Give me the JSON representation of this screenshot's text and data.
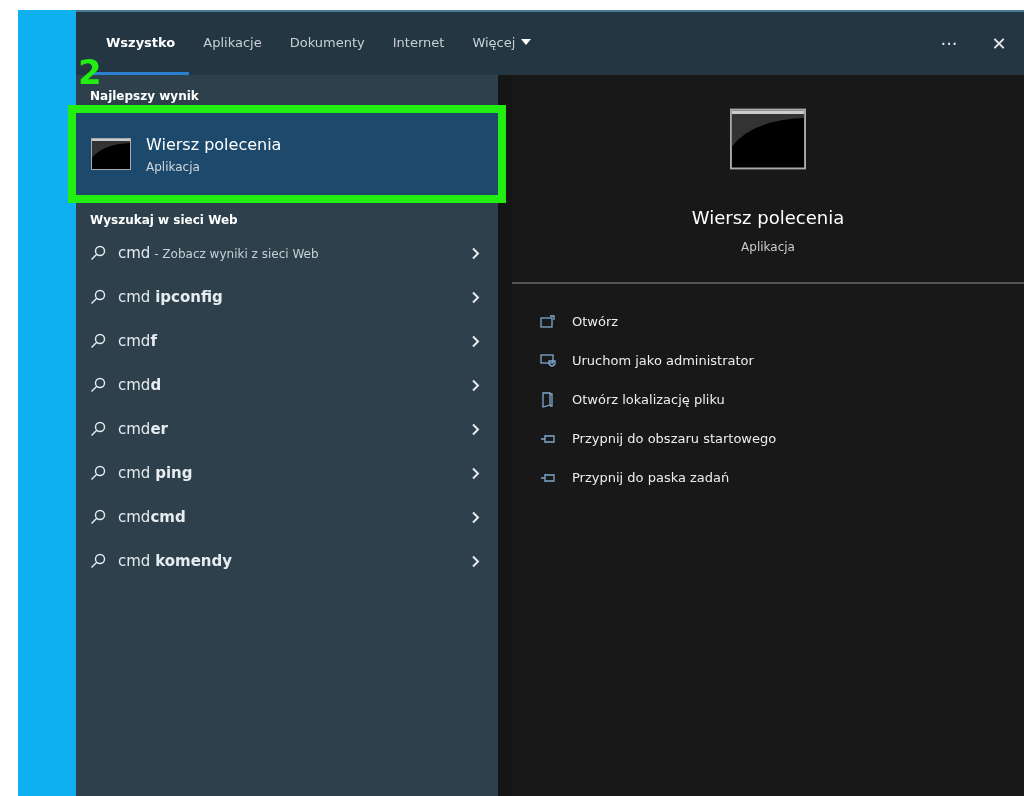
{
  "tabs": [
    {
      "label": "Wszystko",
      "selected": true
    },
    {
      "label": "Aplikacje",
      "selected": false
    },
    {
      "label": "Dokumenty",
      "selected": false
    },
    {
      "label": "Internet",
      "selected": false
    },
    {
      "label": "Więcej",
      "selected": false,
      "kind": "dropdown"
    }
  ],
  "toolbar": {
    "more": "···",
    "close": "✕"
  },
  "annotation": {
    "number": "2",
    "color": "#22ee11"
  },
  "best_match": {
    "heading": "Najlepszy wynik",
    "title": "Wiersz polecenia",
    "subtitle": "Aplikacja",
    "selected": true
  },
  "web": {
    "heading": "Wyszukaj w sieci Web",
    "suggestions": [
      {
        "text": "cmd",
        "hint": "- Zobacz wyniki z sieci Web"
      },
      {
        "text": "cmd **ipconfig**"
      },
      {
        "text": "cmd**f**"
      },
      {
        "text": "cmd**d**"
      },
      {
        "text": "cmd**er**"
      },
      {
        "text": "cmd **ping**"
      },
      {
        "text": "cmd**cmd**"
      },
      {
        "text": "cmd **komendy**"
      }
    ]
  },
  "preview": {
    "title": "Wiersz polecenia",
    "subtitle": "Aplikacja",
    "actions": [
      {
        "kind": "open",
        "label": "Otwórz"
      },
      {
        "kind": "admin",
        "label": "Uruchom jako administrator"
      },
      {
        "kind": "location",
        "label": "Otwórz lokalizację pliku"
      },
      {
        "kind": "pin",
        "label": "Przypnij do obszaru startowego"
      },
      {
        "kind": "pin",
        "label": "Przypnij do paska zadań"
      }
    ]
  }
}
